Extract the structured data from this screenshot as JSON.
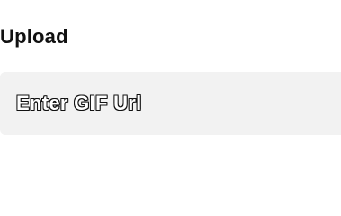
{
  "upload": {
    "title": "Upload",
    "gif_url_input": {
      "value": "",
      "placeholder": "Enter GIF Url"
    }
  }
}
